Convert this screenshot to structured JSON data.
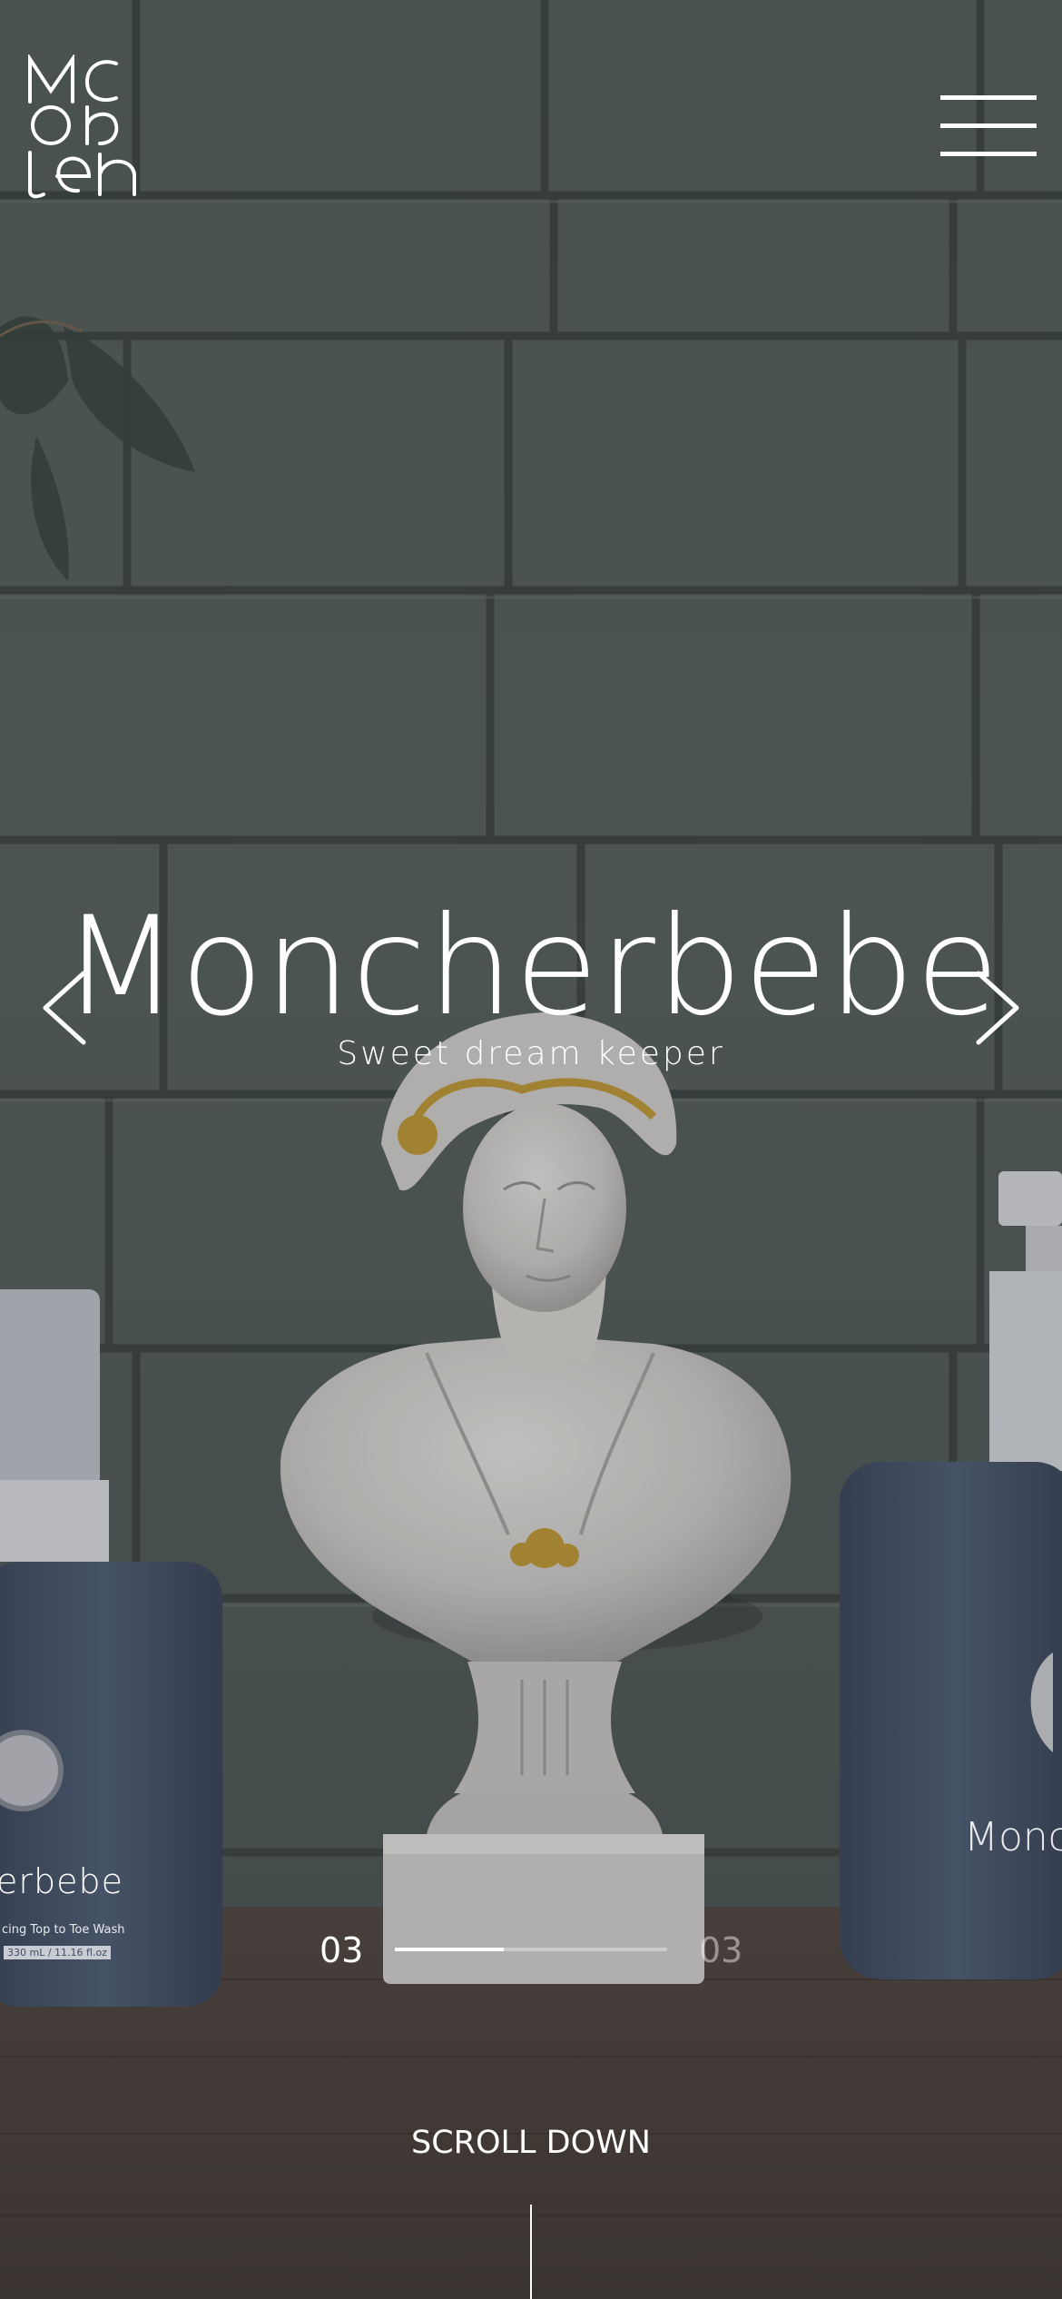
{
  "header": {
    "logo_icon": "moncherbebe-monogram-logo",
    "menu_icon": "hamburger-menu-icon"
  },
  "hero": {
    "title": "Moncherbebe",
    "tagline": "Sweet dream keeper",
    "prev_icon": "chevron-left-icon",
    "next_icon": "chevron-right-icon",
    "product_left_label": "erbebe",
    "product_left_sublabel": "cing Top to Toe Wash",
    "product_left_volume": "330 mL / 11.16 fl.oz",
    "product_right_label": "Monc"
  },
  "pagination": {
    "current": "03",
    "total": "03",
    "progress": 0.4
  },
  "scroll": {
    "label": "SCROLL DOWN"
  },
  "colors": {
    "text": "#ffffff",
    "wall": "#5b6662",
    "shelf": "#4f4640",
    "bottle": "#4d5c74"
  }
}
